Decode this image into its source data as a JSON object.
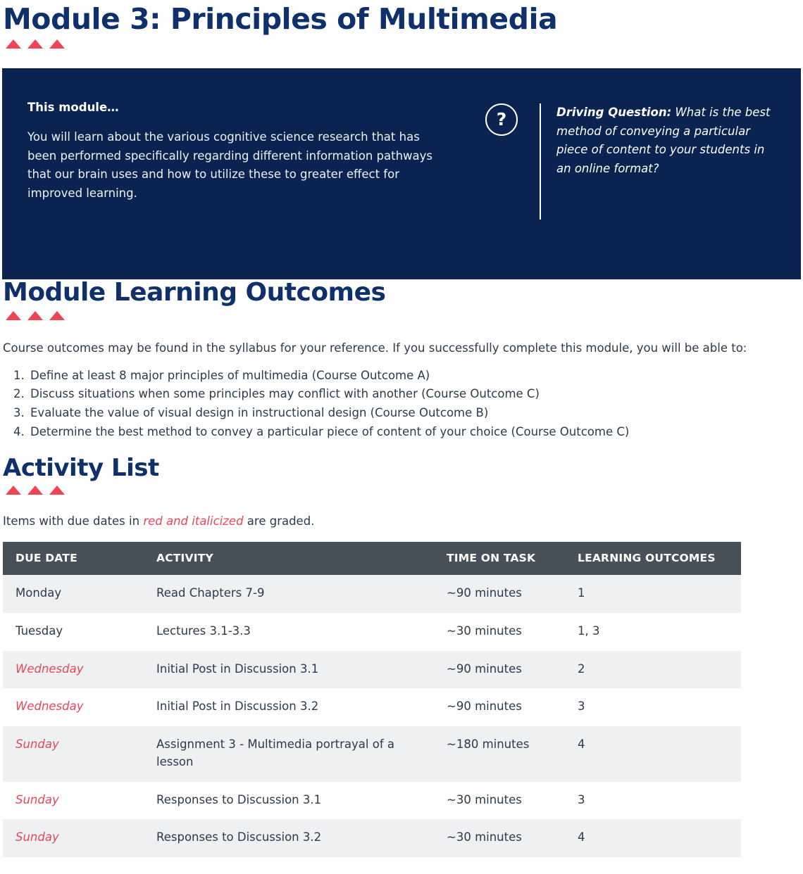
{
  "page": {
    "title": "Module 3: Principles of Multimedia",
    "accent_red": "#ef4452",
    "navy": "#0a2350",
    "heading_navy": "#10306b",
    "table_header_gray": "#465159",
    "row_shade": "#eff0f2"
  },
  "banner": {
    "this_module_label": "This module…",
    "this_module_body": "You will learn about the various cognitive science research that has been performed specifically regarding different information pathways that our brain uses and how to utilize these to greater effect for improved learning.",
    "question_icon": "question-mark-circle-icon",
    "driving_label": "Driving Question:",
    "driving_text": " What is the best method of conveying a particular piece of content to your students in an online format?"
  },
  "outcomes_section": {
    "heading": "Module Learning Outcomes",
    "intro": "Course outcomes may be found in the syllabus for your reference. If you successfully complete this module, you will be able to:",
    "items": [
      "Define at least 8 major principles of multimedia (Course Outcome A)",
      "Discuss situations when some principles may conflict with another (Course Outcome C)",
      "Evaluate the value of visual design in instructional design (Course Outcome B)",
      "Determine the best method to convey a particular piece of content of your choice (Course Outcome C)"
    ]
  },
  "activity_section": {
    "heading": "Activity List",
    "note_before": "Items with due dates in ",
    "note_emphasis": "red and italicized",
    "note_after": " are graded.",
    "columns": [
      "DUE DATE",
      "ACTIVITY",
      "TIME ON TASK",
      "LEARNING OUTCOMES"
    ],
    "rows": [
      {
        "due": "Monday",
        "graded": false,
        "activity": "Read Chapters 7-9",
        "time": "~90 minutes",
        "outcomes": "1"
      },
      {
        "due": "Tuesday",
        "graded": false,
        "activity": "Lectures 3.1-3.3",
        "time": "~30 minutes",
        "outcomes": "1, 3"
      },
      {
        "due": "Wednesday",
        "graded": true,
        "activity": "Initial Post in Discussion 3.1",
        "time": "~90 minutes",
        "outcomes": "2"
      },
      {
        "due": "Wednesday",
        "graded": true,
        "activity": "Initial Post in Discussion 3.2",
        "time": "~90 minutes",
        "outcomes": "3"
      },
      {
        "due": "Sunday",
        "graded": true,
        "activity": "Assignment 3 - Multimedia portrayal of a lesson",
        "time": "~180 minutes",
        "outcomes": "4"
      },
      {
        "due": "Sunday",
        "graded": true,
        "activity": "Responses to Discussion 3.1",
        "time": "~30 minutes",
        "outcomes": "3"
      },
      {
        "due": "Sunday",
        "graded": true,
        "activity": "Responses to Discussion 3.2",
        "time": "~30 minutes",
        "outcomes": "4"
      }
    ]
  }
}
